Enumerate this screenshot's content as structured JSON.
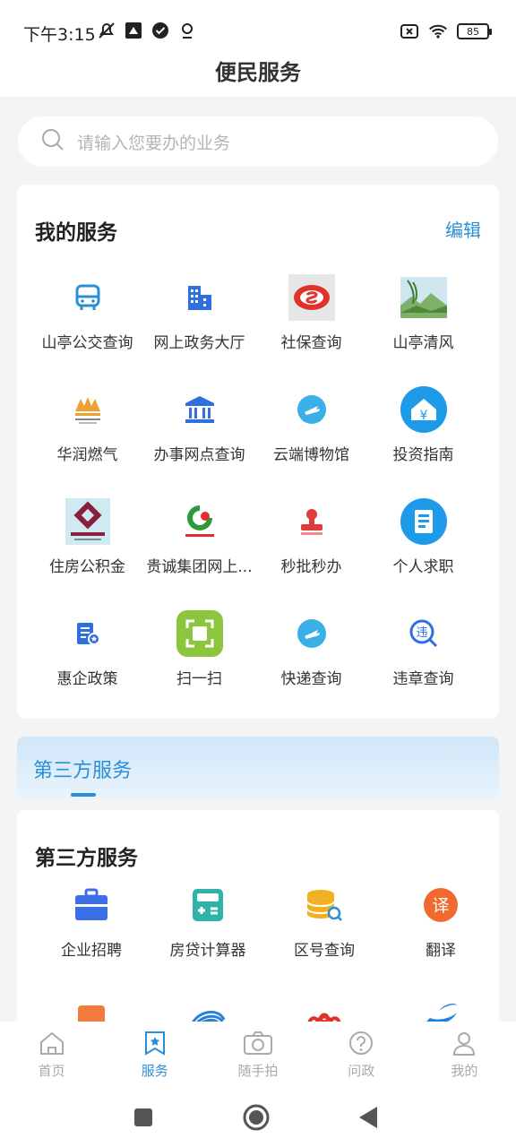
{
  "status": {
    "time": "下午3:15",
    "battery": "85"
  },
  "header": {
    "title": "便民服务"
  },
  "search": {
    "placeholder": "请输入您要办的业务"
  },
  "my_services": {
    "title": "我的服务",
    "edit": "编辑",
    "items": [
      {
        "label": "山亭公交查询",
        "icon": "bus-icon",
        "color": "#2a8fd6"
      },
      {
        "label": "网上政务大厅",
        "icon": "building-icon",
        "color": "#2f6fe0"
      },
      {
        "label": "社保查询",
        "icon": "social-security-logo",
        "color": "#e0322a"
      },
      {
        "label": "山亭清风",
        "icon": "landscape-image",
        "color": "#6aa84f"
      },
      {
        "label": "华润燃气",
        "icon": "china-resources-gas-logo",
        "color": "#f0a030"
      },
      {
        "label": "办事网点查询",
        "icon": "bank-icon",
        "color": "#2f6fe0"
      },
      {
        "label": "云端博物馆",
        "icon": "plane-circle-icon",
        "color": "#3bb0e6"
      },
      {
        "label": "投资指南",
        "icon": "yuan-house-icon",
        "color": "#1e9be8"
      },
      {
        "label": "住房公积金",
        "icon": "housing-fund-logo",
        "color": "#8a1f3d"
      },
      {
        "label": "贵诚集团网上...",
        "icon": "guicheng-group-logo",
        "color": "#2e9a3a"
      },
      {
        "label": "秒批秒办",
        "icon": "stamp-icon",
        "color": "#e03a3a"
      },
      {
        "label": "个人求职",
        "icon": "resume-circle-icon",
        "color": "#1e9be8"
      },
      {
        "label": "惠企政策",
        "icon": "policy-doc-icon",
        "color": "#2f6fe0"
      },
      {
        "label": "扫一扫",
        "icon": "scan-icon",
        "color": "#8cc63f"
      },
      {
        "label": "快递查询",
        "icon": "plane-circle-icon",
        "color": "#3bb0e6"
      },
      {
        "label": "违章查询",
        "icon": "violation-search-icon",
        "color": "#2f6fe0"
      }
    ]
  },
  "third_party_tab": {
    "label": "第三方服务"
  },
  "third_party": {
    "title": "第三方服务",
    "items": [
      {
        "label": "企业招聘",
        "icon": "briefcase-icon",
        "color": "#3a6fe8"
      },
      {
        "label": "房贷计算器",
        "icon": "calculator-icon",
        "color": "#2fb3a8"
      },
      {
        "label": "区号查询",
        "icon": "database-search-icon",
        "color": "#f0b020"
      },
      {
        "label": "翻译",
        "icon": "translate-icon",
        "color": "#f06a30"
      }
    ],
    "partial_icons": [
      {
        "icon": "orange-card-icon",
        "color": "#f27a3a"
      },
      {
        "icon": "china-mobile-icon",
        "color": "#2a7fd6"
      },
      {
        "icon": "china-unicom-icon",
        "color": "#e0322a"
      },
      {
        "icon": "china-telecom-icon",
        "color": "#1e7fe0"
      }
    ]
  },
  "bottom_nav": [
    {
      "label": "首页",
      "icon": "home-icon",
      "active": false
    },
    {
      "label": "服务",
      "icon": "star-bookmark-icon",
      "active": true
    },
    {
      "label": "随手拍",
      "icon": "camera-icon",
      "active": false
    },
    {
      "label": "问政",
      "icon": "question-icon",
      "active": false
    },
    {
      "label": "我的",
      "icon": "user-icon",
      "active": false
    }
  ],
  "colors": {
    "accent": "#2a8fd6",
    "background": "#f3f4f6"
  }
}
